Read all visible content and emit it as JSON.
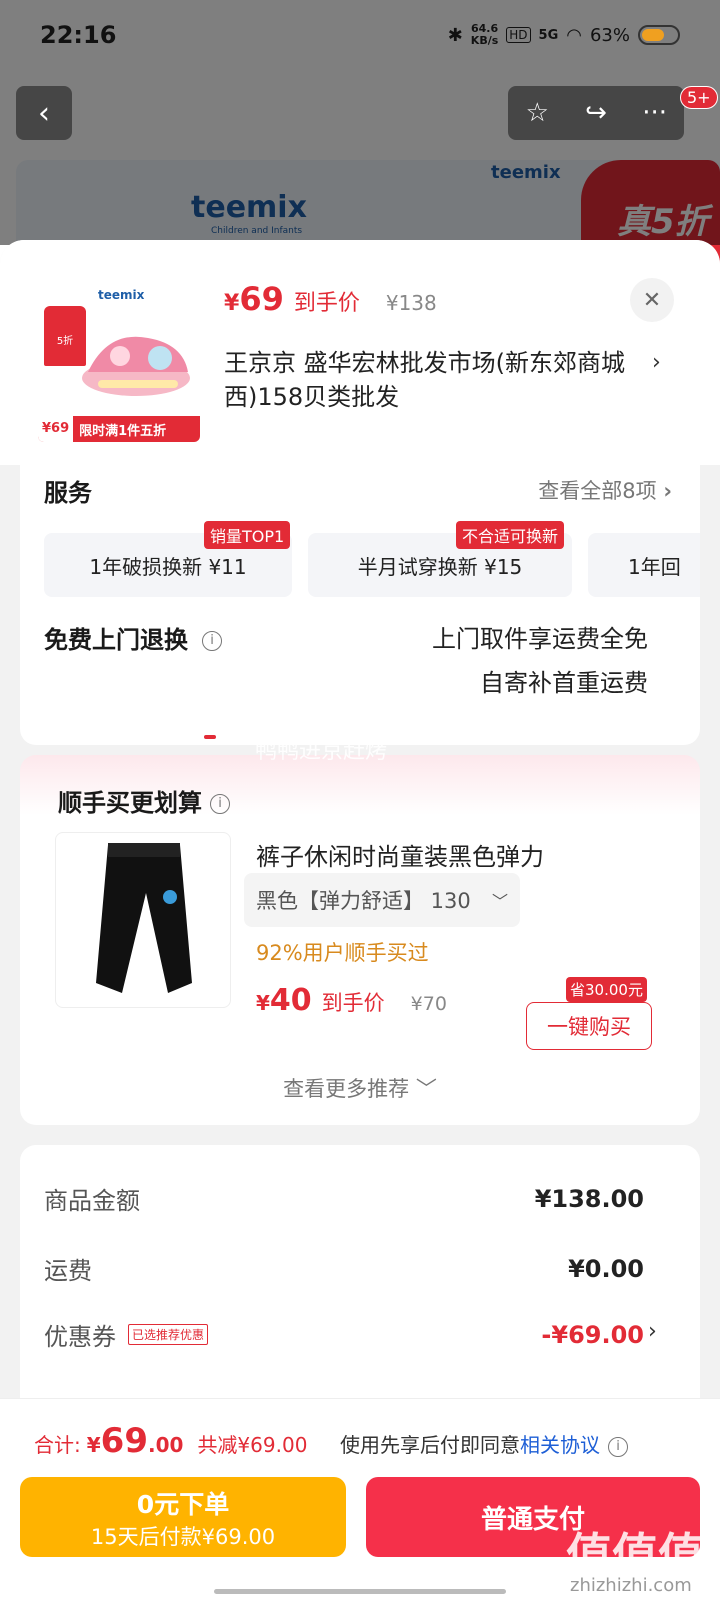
{
  "status_bar": {
    "time": "22:16",
    "net_speed_value": "64.6",
    "net_speed_unit": "KB/s",
    "hd": "HD",
    "signal": "5G",
    "battery": "63%"
  },
  "top_nav": {
    "badge": "5+"
  },
  "background": {
    "brand_logo": "teemix",
    "brand_sub": "Children and Infants",
    "promo_text": "真5折"
  },
  "product": {
    "thumb_brand": "teemix",
    "thumb_tag": "5折",
    "thumb_price": "¥69",
    "thumb_slogan": "限时满1件五折",
    "price_currency": "¥",
    "price": "69",
    "price_label": "到手价",
    "original_price": "¥138",
    "address": "王京京  盛华宏林批发市场(新东郊商城西)158贝类批发"
  },
  "service": {
    "title": "服务",
    "view_all": "查看全部8项",
    "items": [
      {
        "label": "1年破损换新  ¥11",
        "tag": "销量TOP1"
      },
      {
        "label": "半月试穿换新  ¥15",
        "tag": "不合适可换新"
      },
      {
        "label": "1年回",
        "tag": ""
      }
    ],
    "returns_label": "免费上门退换",
    "returns_line1": "上门取件享运费全免",
    "returns_line2": "自寄补首重运费"
  },
  "upsell": {
    "watermark": "鸭鸭进京赶烤",
    "title": "顺手买更划算",
    "name": "裤子休闲时尚童装黑色弹力",
    "sku": "黑色【弹力舒适】 130",
    "bought": "92%用户顺手买过",
    "price_currency": "¥",
    "price": "40",
    "price_label": "到手价",
    "original_price": "¥70",
    "save_tag": "省30.00元",
    "buy_button": "一键购买",
    "see_more": "查看更多推荐"
  },
  "summary": {
    "goods_label": "商品金额",
    "goods_value": "¥138.00",
    "shipping_label": "运费",
    "shipping_value": "¥0.00",
    "coupon_label": "优惠券",
    "coupon_tag": "已选推荐优惠",
    "coupon_value": "-¥69.00"
  },
  "bottom": {
    "total_label": "合计:",
    "total_currency": "¥",
    "total_int": "69",
    "total_dec": ".00",
    "discount": "共减¥69.00",
    "agree_text": "使用先享后付即同意",
    "agree_link": "相关协议",
    "pay_later_line1": "0元下单",
    "pay_later_line2": "15天后付款¥69.00",
    "pay_button": "普通支付",
    "site_mark": "值值值",
    "site_url": "zhizhizhi.com"
  },
  "colors": {
    "accent_red": "#e22b36",
    "pay_later_yellow": "#ffb300",
    "link_blue": "#1e5fd6"
  }
}
